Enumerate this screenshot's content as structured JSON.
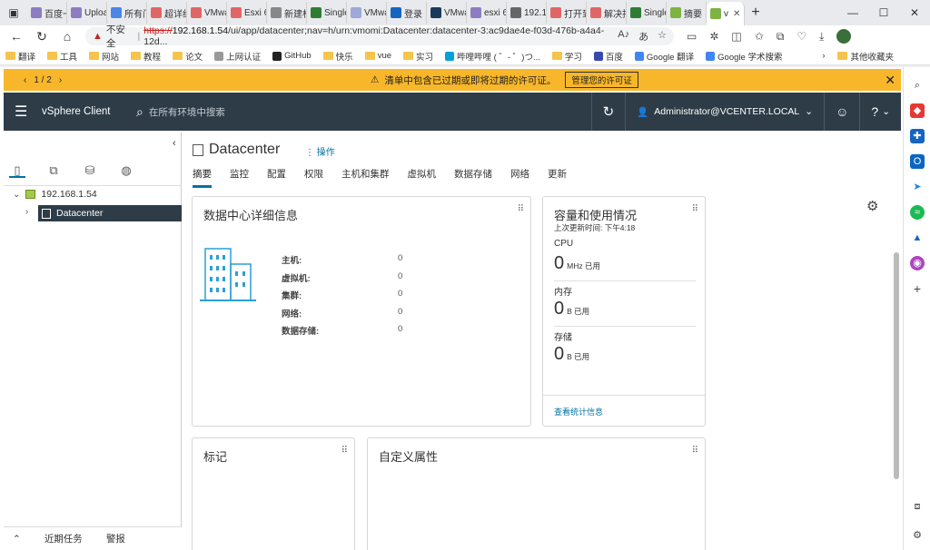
{
  "tabs": [
    {
      "label": "百度一",
      "color": "#8e7cc3",
      "icon": "paw-icon"
    },
    {
      "label": "Uploa",
      "color": "#8e7cc3",
      "icon": "paw-icon"
    },
    {
      "label": "所有门",
      "color": "#4a86e8",
      "icon": "page-icon"
    },
    {
      "label": "超详细",
      "color": "#e06666",
      "icon": "c-icon"
    },
    {
      "label": "VMwa",
      "color": "#e06666",
      "icon": "c-icon"
    },
    {
      "label": "Esxi 6",
      "color": "#e06666",
      "icon": "c-icon"
    },
    {
      "label": "新建标",
      "color": "#888888",
      "icon": "page-icon"
    },
    {
      "label": "Single",
      "color": "#2e7d32",
      "icon": "leaf-icon"
    },
    {
      "label": "VMwa",
      "color": "#9fa8da",
      "icon": "cloud-icon"
    },
    {
      "label": "登录",
      "color": "#1565c0",
      "icon": "login-icon"
    },
    {
      "label": "VMwa",
      "color": "#1a3a5c",
      "icon": "vm-icon"
    },
    {
      "label": "esxi 6",
      "color": "#8e7cc3",
      "icon": "paw-icon"
    },
    {
      "label": "192.1",
      "color": "#666666",
      "icon": "page-icon"
    },
    {
      "label": "打开到",
      "color": "#e06666",
      "icon": "c-icon"
    },
    {
      "label": "解决找",
      "color": "#e06666",
      "icon": "c-icon"
    },
    {
      "label": "Single",
      "color": "#2e7d32",
      "icon": "leaf-icon"
    },
    {
      "label": "摘要 ·",
      "color": "#7cb342",
      "icon": "vsphere-icon"
    },
    {
      "label": "v",
      "color": "#7cb342",
      "icon": "vsphere-icon",
      "active": true
    }
  ],
  "address": {
    "insecure_label": "不安全",
    "scheme": "https://",
    "host": "192.168.1.54",
    "path": "/ui/app/datacenter;nav=h/urn:vmomi:Datacenter:datacenter-3:ac9dae4e-f03d-476b-a4a4-12d..."
  },
  "bookmarks": [
    "翻译",
    "工具",
    "网站",
    "教程",
    "论文",
    "上网认证",
    "GitHub",
    "快乐",
    "vue",
    "实习",
    "哔哩哔哩 ( ゜- ゜)つ...",
    "学习",
    "百度",
    "Google 翻译",
    "Google 学术搜索"
  ],
  "bookmarks_other": "其他收藏夹",
  "banner": {
    "pager": "1 / 2",
    "message": "清单中包含已过期或即将过期的许可证。",
    "button": "管理您的许可证"
  },
  "header": {
    "brand": "vSphere Client",
    "search_placeholder": "在所有环境中搜索",
    "user": "Administrator@VCENTER.LOCAL"
  },
  "tree": {
    "host": "192.168.1.54",
    "datacenter": "Datacenter"
  },
  "bottom": {
    "tasks": "近期任务",
    "alarms": "警报"
  },
  "main": {
    "title": "Datacenter",
    "actions": "操作",
    "tabs": [
      "摘要",
      "监控",
      "配置",
      "权限",
      "主机和集群",
      "虚拟机",
      "数据存储",
      "网络",
      "更新"
    ]
  },
  "details": {
    "title": "数据中心详细信息",
    "rows": [
      {
        "label": "主机:",
        "value": "0"
      },
      {
        "label": "虚拟机:",
        "value": "0"
      },
      {
        "label": "集群:",
        "value": "0"
      },
      {
        "label": "网络:",
        "value": "0"
      },
      {
        "label": "数据存储:",
        "value": "0"
      }
    ]
  },
  "capacity": {
    "title": "容量和使用情况",
    "updated": "上次更新时间: 下午4:18",
    "cpu": {
      "label": "CPU",
      "value": "0",
      "unit": "MHz 已用"
    },
    "memory": {
      "label": "内存",
      "value": "0",
      "unit": "B 已用"
    },
    "storage": {
      "label": "存储",
      "value": "0",
      "unit": "B 已用"
    },
    "link": "查看统计信息"
  },
  "tags": {
    "title": "标记"
  },
  "custom": {
    "title": "自定义属性"
  }
}
